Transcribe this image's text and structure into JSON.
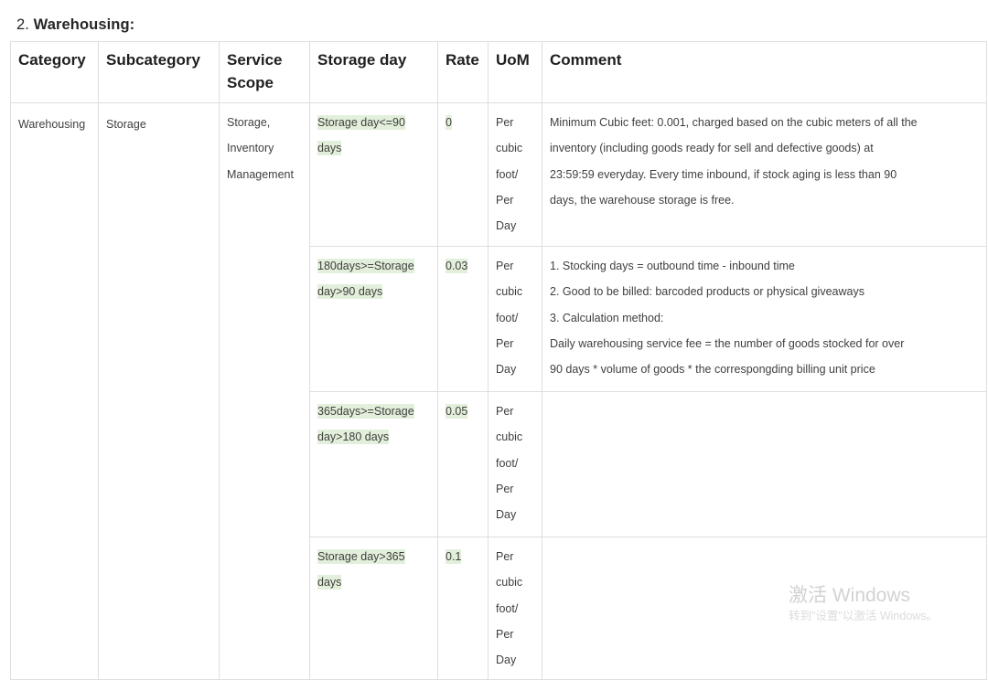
{
  "heading": {
    "number": "2.",
    "title": "Warehousing:",
    "full": "2. Warehousing:"
  },
  "table": {
    "columns": [
      {
        "key": "category",
        "label": "Category"
      },
      {
        "key": "subcategory",
        "label": "Subcategory"
      },
      {
        "key": "scope",
        "label": "Service Scope"
      },
      {
        "key": "storage_day",
        "label": "Storage day"
      },
      {
        "key": "rate",
        "label": "Rate"
      },
      {
        "key": "uom",
        "label": "UoM"
      },
      {
        "key": "comment",
        "label": "Comment"
      }
    ],
    "highlight_color": "#e2efda",
    "border_color": "#dedede",
    "merged": {
      "category": "Warehousing",
      "subcategory": "Storage",
      "scope": "Storage, Inventory Management"
    },
    "rows": [
      {
        "storage_day": "Storage day<=90 days",
        "storage_day_highlighted": true,
        "rate": "0",
        "rate_highlighted": true,
        "uom_lines": [
          "Per",
          "cubic",
          "foot/",
          "Per",
          "Day"
        ],
        "comment_lines": [
          "Minimum Cubic feet: 0.001, charged based on the cubic meters of all the",
          "inventory (including goods ready for sell and defective goods) at",
          "23:59:59 everyday. Every time inbound, if stock aging is less than 90",
          "days, the warehouse storage is free."
        ]
      },
      {
        "storage_day": "180days>=Storage day>90 days",
        "storage_day_highlighted": true,
        "rate": "0.03",
        "rate_highlighted": true,
        "uom_lines": [
          "Per",
          "cubic",
          "foot/",
          "Per",
          "Day"
        ],
        "comment_lines": [
          "1. Stocking days = outbound time - inbound time",
          "2. Good to be billed: barcoded products or physical giveaways",
          "3. Calculation method:",
          "Daily warehousing service fee = the number of goods stocked for over",
          "90 days * volume of goods * the correspongding billing unit price"
        ]
      },
      {
        "storage_day": "365days>=Storage day>180 days",
        "storage_day_highlighted": true,
        "rate": "0.05",
        "rate_highlighted": true,
        "uom_lines": [
          "Per",
          "cubic",
          "foot/",
          "Per",
          "Day"
        ],
        "comment_lines": []
      },
      {
        "storage_day": "Storage day>365 days",
        "storage_day_highlighted": true,
        "rate": "0.1",
        "rate_highlighted": true,
        "uom_lines": [
          "Per",
          "cubic",
          "foot/",
          "Per",
          "Day"
        ],
        "comment_lines": []
      }
    ]
  },
  "watermark": {
    "title": "激活 Windows",
    "subtitle": "转到\"设置\"以激活 Windows。"
  }
}
